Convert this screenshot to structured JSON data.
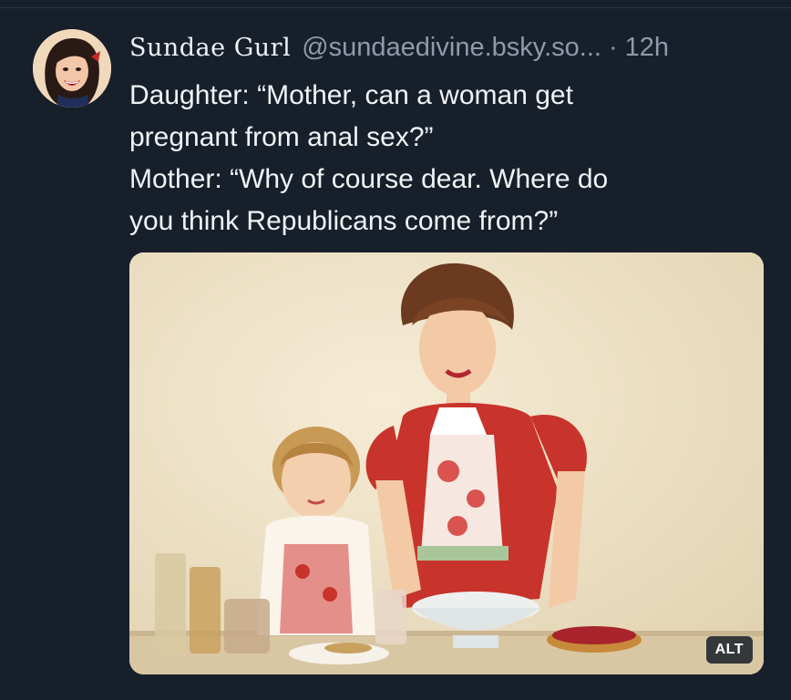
{
  "post": {
    "display_name": "Sundae Gurl",
    "handle": "@sundaedivine.bsky.so...",
    "separator": "·",
    "time": "12h",
    "lines": [
      "Daughter: “Mother, can a woman get",
      "pregnant from anal sex?”",
      "Mother: “Why of course dear. Where do",
      "you think Republicans come from?”"
    ]
  },
  "media": {
    "alt_label": "ALT"
  },
  "icons": {
    "avatar": "avatar-photo"
  },
  "colors": {
    "background": "#171f2a",
    "text": "#f1f3f5",
    "muted": "#8e9bac"
  }
}
